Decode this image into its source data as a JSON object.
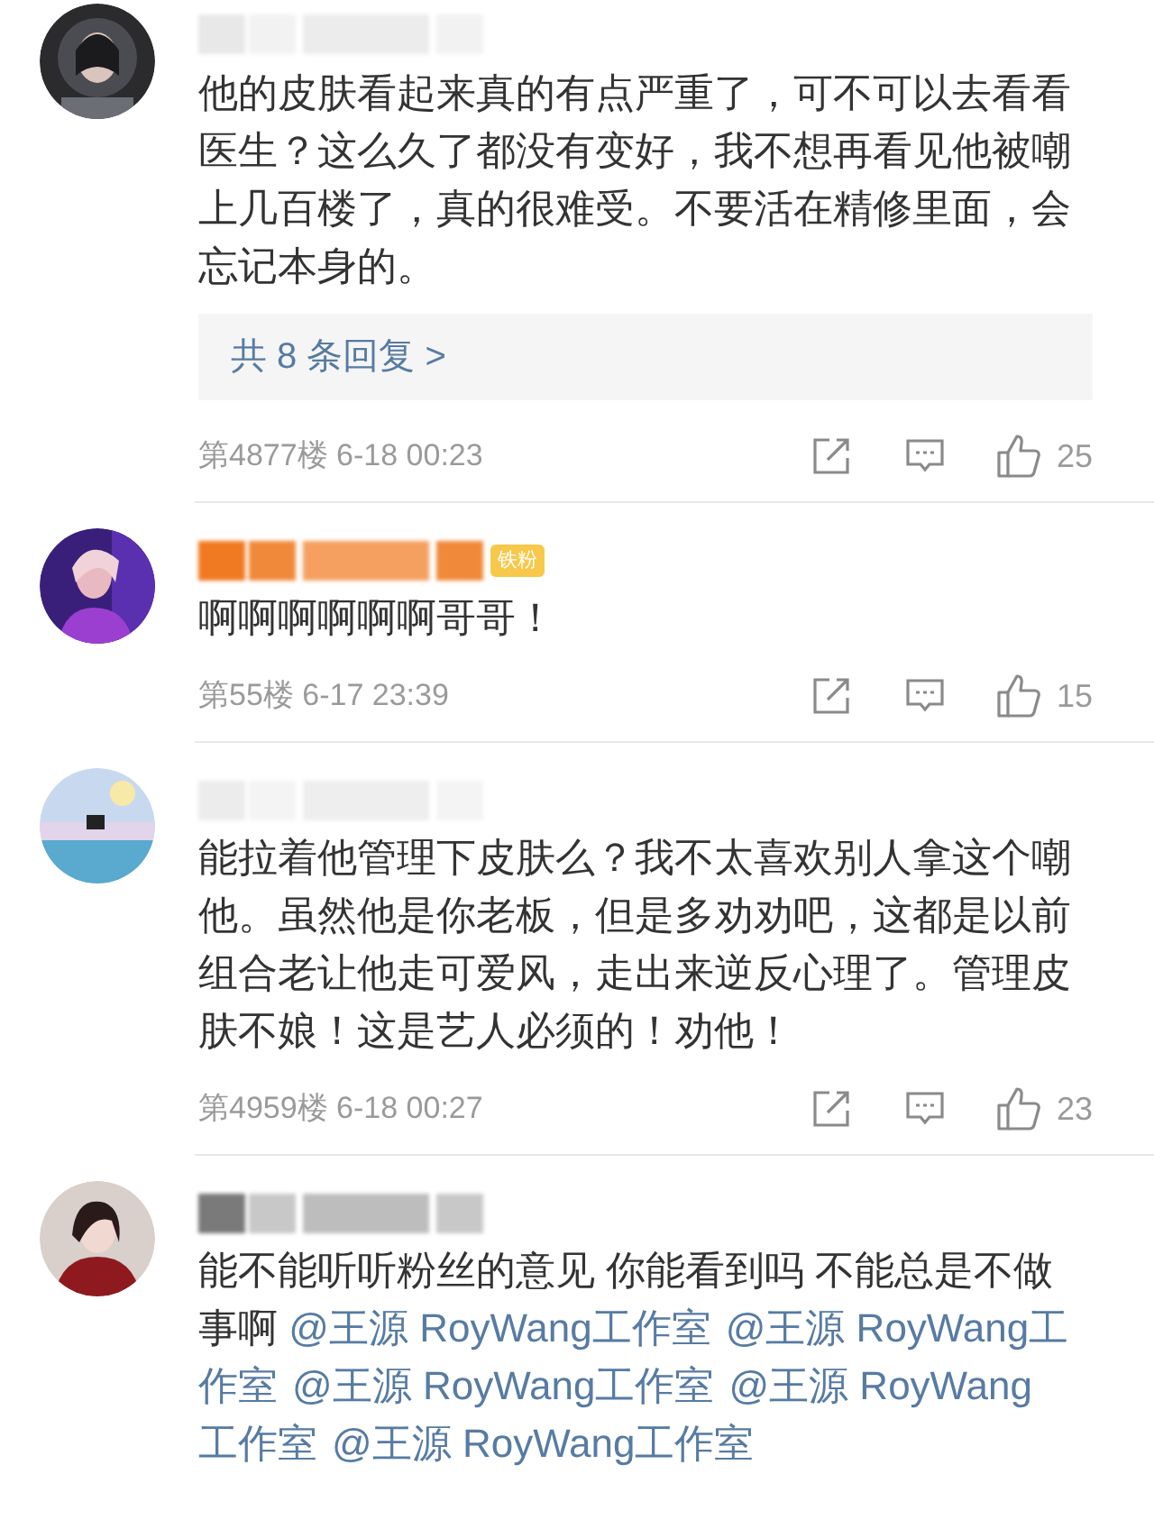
{
  "comments": [
    {
      "segments": [
        {
          "kind": "text",
          "text": "他的皮肤看起来真的有点严重了，可不可以去看看医生？这么久了都没有变好，我不想再看见他被嘲上几百楼了，真的很难受。不要活在精修里面，会忘记本身的。"
        }
      ],
      "replies": "共 8 条回复 >",
      "meta": "第4877楼 6-18 00:23",
      "likes": "25"
    },
    {
      "badge": "铁粉",
      "segments": [
        {
          "kind": "text",
          "text": "啊啊啊啊啊啊哥哥！"
        }
      ],
      "meta": "第55楼 6-17 23:39",
      "likes": "15"
    },
    {
      "segments": [
        {
          "kind": "text",
          "text": "能拉着他管理下皮肤么？我不太喜欢别人拿这个嘲他。虽然他是你老板，但是多劝劝吧，这都是以前组合老让他走可爱风，走出来逆反心理了。管理皮肤不娘！这是艺人必须的！劝他！"
        }
      ],
      "meta": "第4959楼 6-18 00:27",
      "likes": "23"
    },
    {
      "segments": [
        {
          "kind": "text",
          "text": "能不能听听粉丝的意见 你能看到吗 不能总是不做事啊 "
        },
        {
          "kind": "mention",
          "text": "@王源 RoyWang工作室"
        },
        {
          "kind": "mention",
          "text": "@王源 RoyWang工作室"
        },
        {
          "kind": "mention",
          "text": "@王源 RoyWang工作室"
        },
        {
          "kind": "mention",
          "text": "@王源 RoyWang工作室"
        },
        {
          "kind": "mention",
          "text": "@王源 RoyWang工作室"
        }
      ]
    }
  ]
}
